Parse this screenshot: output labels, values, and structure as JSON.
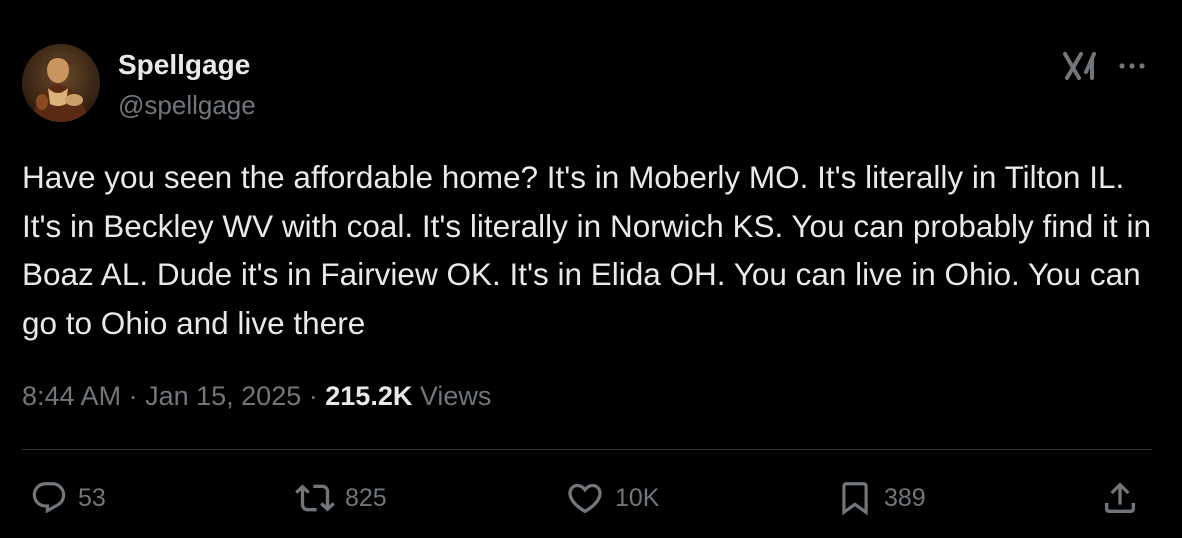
{
  "author": {
    "name": "Spellgage",
    "handle": "@spellgage"
  },
  "tweet": {
    "text": "Have you seen the affordable home? It's in Moberly MO. It's literally in Tilton IL. It's in Beckley WV with coal. It's literally in Norwich KS. You can probably find it in Boaz AL. Dude it's in Fairview OK. It's in Elida OH. You can live in Ohio. You can go to Ohio and live there",
    "time": "8:44 AM",
    "separator": "·",
    "date": "Jan 15, 2025",
    "views_count": "215.2K",
    "views_label": "Views"
  },
  "actions": {
    "replies": "53",
    "reposts": "825",
    "likes": "10K",
    "bookmarks": "389"
  },
  "icons": {
    "header": [
      "grok-icon",
      "more-icon"
    ],
    "actions": [
      "reply-icon",
      "repost-icon",
      "like-icon",
      "bookmark-icon",
      "share-icon"
    ]
  },
  "colors": {
    "background": "#000000",
    "primary_text": "#e7e9ea",
    "secondary_text": "#71767b",
    "divider": "#2f3336"
  }
}
